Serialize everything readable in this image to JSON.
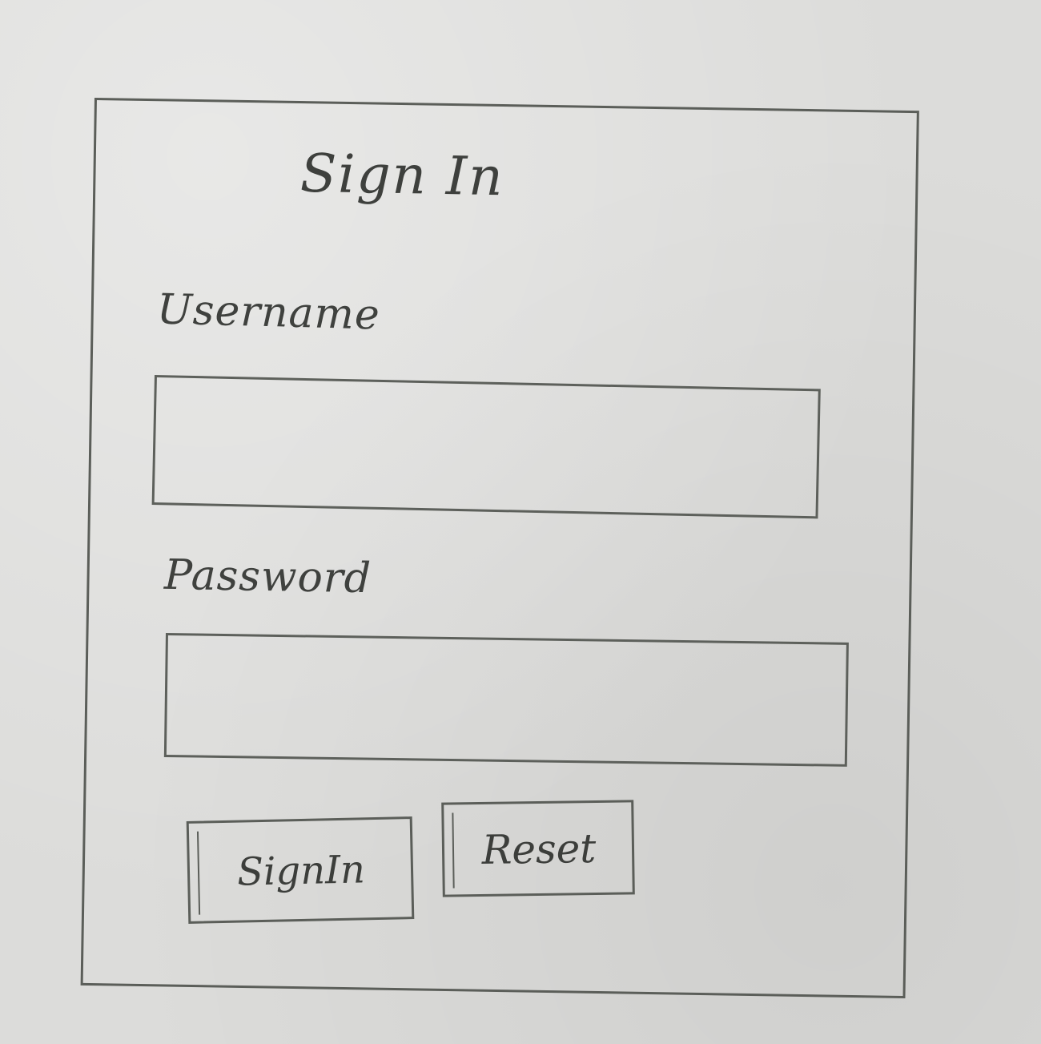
{
  "form": {
    "title": "Sign In",
    "username_label": "Username",
    "password_label": "Password",
    "username_value": "",
    "password_value": "",
    "signin_button": "SignIn",
    "reset_button": "Reset"
  }
}
